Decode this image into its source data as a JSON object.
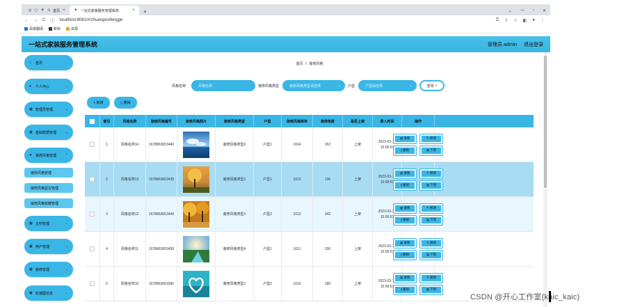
{
  "browser": {
    "tabs": [
      {
        "label": "首页",
        "active": false
      },
      {
        "label": "一站式家装服务管理系统",
        "active": true
      }
    ],
    "url": "localhost:8081/#/zhuangxiufengge",
    "bookmarks": [
      "百度翻译",
      "新标",
      "资源"
    ]
  },
  "app": {
    "title": "一站式家装服务管理系统",
    "user_label": "管理员 admin",
    "logout_label": "退出登录",
    "accent": "#3ab6e6"
  },
  "sidebar": {
    "items": [
      {
        "label": "首页",
        "icon": "home-icon",
        "expandable": false
      },
      {
        "label": "个人中心",
        "icon": "user-icon",
        "expandable": true
      },
      {
        "label": "管理员管理",
        "icon": "grid-icon",
        "expandable": true
      },
      {
        "label": "基础数据管理",
        "icon": "grid-icon",
        "expandable": true
      },
      {
        "label": "装修风格管理",
        "icon": "send-icon",
        "expandable": true
      },
      {
        "label": "主材管理",
        "icon": "grid-icon",
        "expandable": true
      },
      {
        "label": "用户管理",
        "icon": "grid-icon",
        "expandable": true
      },
      {
        "label": "装修管理",
        "icon": "grid-icon",
        "expandable": true
      },
      {
        "label": "轮播图信息",
        "icon": "grid-icon",
        "expandable": true
      }
    ],
    "subitems": [
      "装修风格管理",
      "装修风格留言管理",
      "装修风格收藏管理"
    ]
  },
  "breadcrumb": {
    "home": "首页",
    "sep": "//",
    "current": "装修风格"
  },
  "search": {
    "name_label": "风格名称",
    "name_placeholder": "风格名称",
    "type_label": "装修风格类型",
    "type_placeholder": "装修风格类型请选择",
    "huxing_label": "户型",
    "huxing_placeholder": "户型请选择",
    "search_label": "查询"
  },
  "actions": {
    "add_label": "+ 新增",
    "delete_label": "删除"
  },
  "table": {
    "headers": [
      "索引",
      "风格名称",
      "装修风格编号",
      "装修风格照片",
      "装修风格类型",
      "户型",
      "装修风格库存",
      "装修热度",
      "是否上架",
      "录入时间",
      "操作"
    ],
    "rows": [
      {
        "index": "1",
        "name": "风格名称14",
        "code": "1678863653440",
        "type": "装修风格类型3",
        "huxing": "户型1",
        "stock": "1014",
        "heat": "262",
        "status": "上架",
        "time": "2023-03-15 15:00:53",
        "photo": "sea-sky"
      },
      {
        "index": "2",
        "name": "风格名称13",
        "code": "1678863653435",
        "type": "装修风格类型1",
        "huxing": "户型1",
        "stock": "1013",
        "heat": "136",
        "status": "上架",
        "time": "2023-03-15 15:00:53",
        "photo": "autumn-tree"
      },
      {
        "index": "3",
        "name": "风格名称12",
        "code": "1678863653449",
        "type": "装修风格类型1",
        "huxing": "户型2",
        "stock": "1012",
        "heat": "342",
        "status": "上架",
        "time": "2023-03-15 15:00:53",
        "photo": "golden-forest"
      },
      {
        "index": "4",
        "name": "风格名称11",
        "code": "1678863653458",
        "type": "装修风格类型4",
        "huxing": "户型1",
        "stock": "1011",
        "heat": "330",
        "status": "上架",
        "time": "2023-03-15 15:00:53",
        "photo": "sunrise-stream"
      },
      {
        "index": "5",
        "name": "风格名称10",
        "code": "1678863653396",
        "type": "装修风格类型1",
        "huxing": "户型2",
        "stock": "1010",
        "heat": "185",
        "status": "上架",
        "time": "2023-03-15 15:00:53",
        "photo": "heart-beach"
      }
    ],
    "op_labels": {
      "detail": "详情",
      "edit": "修改",
      "delete": "删除",
      "off": "下架"
    }
  },
  "watermark": "CSDN @开心工作室(kaic_kaic)"
}
